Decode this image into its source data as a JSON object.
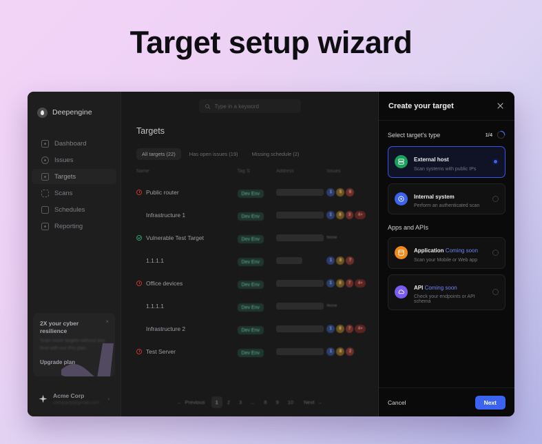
{
  "page": {
    "title": "Target setup wizard"
  },
  "sidebar": {
    "brand": "Deepengine",
    "items": [
      {
        "label": "Dashboard",
        "icon": "dashboard-icon"
      },
      {
        "label": "Issues",
        "icon": "alert-circle-icon"
      },
      {
        "label": "Targets",
        "icon": "target-icon"
      },
      {
        "label": "Scans",
        "icon": "scan-icon"
      },
      {
        "label": "Schedules",
        "icon": "calendar-icon"
      },
      {
        "label": "Reporting",
        "icon": "report-icon"
      }
    ],
    "promo": {
      "title": "2X your cyber resilience",
      "subtitle": "Scan more targets without any limit with our Pro plan.",
      "cta": "Upgrade plan",
      "close": "×"
    },
    "org": {
      "name": "Acme Corp",
      "email": "company@gmail.com",
      "chevron": "›"
    }
  },
  "topbar": {
    "search_placeholder": "Type in a keyword"
  },
  "main": {
    "heading": "Targets",
    "tabs": [
      {
        "label": "All targets (22)",
        "active": true
      },
      {
        "label": "Has open issues (19)",
        "active": false
      },
      {
        "label": "Missing schedule (2)",
        "active": false
      }
    ],
    "columns": [
      "Name",
      "Tag",
      "Address",
      "Issues"
    ],
    "sort_glyph": "⇅",
    "rows": [
      {
        "name": "Public router",
        "status": "warn",
        "tag": "Dev Env",
        "address_width": "full",
        "issues": [
          "1",
          "5",
          "6"
        ],
        "issues_none": ""
      },
      {
        "name": "Infrastructure 1",
        "status": "none",
        "tag": "Dev Env",
        "address_width": "full",
        "issues": [
          "1",
          "8",
          "3",
          "4+"
        ],
        "issues_none": ""
      },
      {
        "name": "Vulnerable Test Target",
        "status": "ok",
        "tag": "Dev Env",
        "address_width": "full",
        "issues": [],
        "issues_none": "None"
      },
      {
        "name": "1.1.1.1",
        "status": "none",
        "tag": "Dev Env",
        "address_width": "short",
        "issues": [
          "1",
          "8",
          "7"
        ],
        "issues_none": ""
      },
      {
        "name": "Office devices",
        "status": "warn",
        "tag": "Dev Env",
        "address_width": "full",
        "issues": [
          "1",
          "8",
          "7",
          "4+"
        ],
        "issues_none": ""
      },
      {
        "name": "1.1.1.1",
        "status": "none",
        "tag": "Dev Env",
        "address_width": "full",
        "issues": [],
        "issues_none": "None"
      },
      {
        "name": "Infrastructure 2",
        "status": "none",
        "tag": "Dev Env",
        "address_width": "full",
        "issues": [
          "1",
          "8",
          "7",
          "4+"
        ],
        "issues_none": ""
      },
      {
        "name": "Test Server",
        "status": "warn",
        "tag": "Dev Env",
        "address_width": "full",
        "issues": [
          "1",
          "8",
          "2"
        ],
        "issues_none": ""
      }
    ],
    "pagination": {
      "previous": "Previous",
      "next": "Next",
      "prev_glyph": "←",
      "next_glyph": "→",
      "pages": [
        "1",
        "2",
        "3",
        "...",
        "8",
        "9",
        "10"
      ],
      "current": "1"
    }
  },
  "drawer": {
    "title": "Create your target",
    "close_glyph": "×",
    "section_label": "Select target's type",
    "step_text": "1/4",
    "step_progress": 25,
    "types": [
      {
        "title": "External host",
        "subtitle": "Scan systems with public IPs",
        "icon": "server-icon",
        "icon_color": "green",
        "selected": true,
        "coming_soon": ""
      },
      {
        "title": "Internal system",
        "subtitle": "Perform an authenticated scan",
        "icon": "target-crosshair-icon",
        "icon_color": "blue",
        "selected": false,
        "coming_soon": ""
      }
    ],
    "group_title": "Apps and APIs",
    "apps": [
      {
        "title": "Application",
        "coming_soon": "Coming soon",
        "subtitle": "Scan your Mobile or Web app",
        "icon": "app-window-icon",
        "icon_color": "orange",
        "selected": false
      },
      {
        "title": "API",
        "coming_soon": "Coming soon",
        "subtitle": "Check your endpoints or API schema",
        "icon": "cloud-icon",
        "icon_color": "purple",
        "selected": false
      }
    ],
    "cancel_label": "Cancel",
    "next_label": "Next"
  },
  "colors": {
    "accent": "#3b63ef",
    "green": "#1aa05c",
    "orange": "#ef8a1b",
    "purple": "#7a5cf0",
    "app_bg": "#191919",
    "drawer_bg": "#0a0a0a"
  }
}
